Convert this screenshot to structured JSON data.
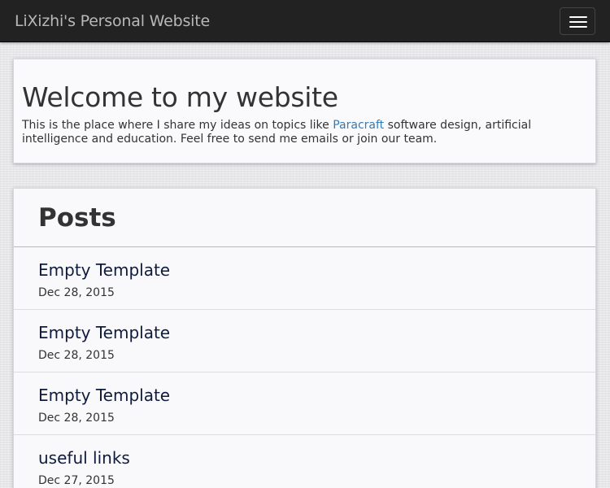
{
  "navbar": {
    "brand": "LiXizhi's Personal Website",
    "toggle_icon": "hamburger-menu-icon"
  },
  "jumbotron": {
    "heading": "Welcome to my website",
    "intro_before": "This is the place where I share my ideas on topics like ",
    "intro_link": "Paracraft",
    "intro_after": " software design, artificial intelligence and education. Feel free to send me emails or join our team."
  },
  "posts": {
    "heading": "Posts",
    "items": [
      {
        "title": "Empty Template",
        "date": "Dec 28, 2015"
      },
      {
        "title": "Empty Template",
        "date": "Dec 28, 2015"
      },
      {
        "title": "Empty Template",
        "date": "Dec 28, 2015"
      },
      {
        "title": "useful links",
        "date": "Dec 27, 2015"
      }
    ]
  },
  "colors": {
    "navbar_bg": "#222222",
    "link": "#337ab7",
    "post_title": "#0f1b3d"
  }
}
